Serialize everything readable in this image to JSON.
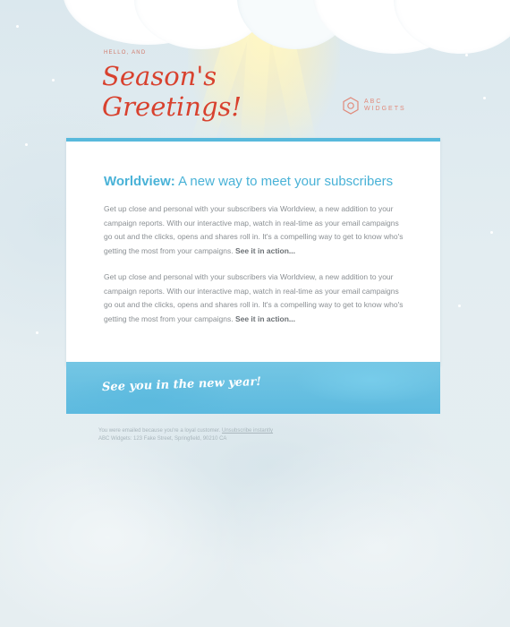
{
  "header": {
    "eyebrow": "HELLO, AND",
    "title_line1": "Season's",
    "title_line2": "Greetings!"
  },
  "brand": {
    "logo_line1": "ABC",
    "logo_line2": "WIDGETS",
    "icon": "hexagon-logo-icon"
  },
  "article": {
    "title_strong": "Worldview:",
    "title_rest": "A new way to meet your subscribers",
    "paragraphs": [
      {
        "text": "Get up close and personal with your subscribers via Worldview, a new addition to your campaign reports. With our interactive map, watch in real-time as your email campaigns go out and the clicks, opens and shares roll in. It's a compelling way to get to know who's getting the most from your campaigns. ",
        "cta": "See it in action..."
      },
      {
        "text": "Get up close and personal with your subscribers via Worldview, a new addition to your campaign reports. With our interactive map, watch in real-time as your email campaigns go out and the clicks, opens and shares roll in. It's a compelling way to get to know who's getting the most from your campaigns. ",
        "cta": "See it in action..."
      }
    ]
  },
  "banner": {
    "text": "See you in the new year!"
  },
  "footer": {
    "notice": "You were emailed because you're a loyal customer. ",
    "unsubscribe": "Unsubscribe instantly",
    "address": "ABC Widgets: 123 Fake Street, Springfield, 90210 CA"
  },
  "colors": {
    "accent": "#49b2d7",
    "greeting_red": "#d8412e",
    "background": "#e6eef1"
  }
}
